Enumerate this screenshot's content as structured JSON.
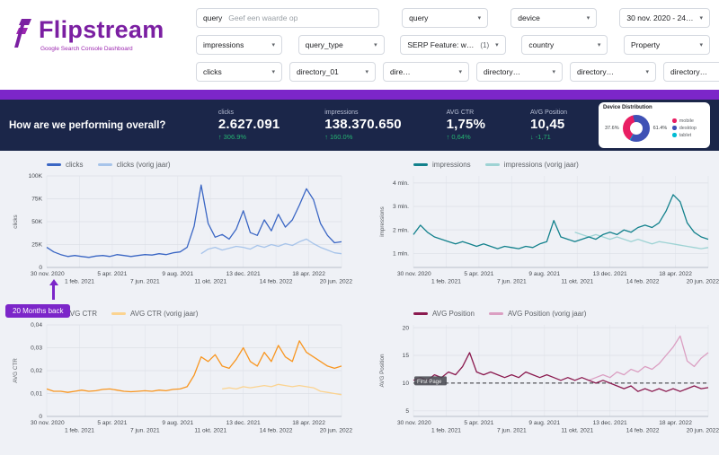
{
  "brand": {
    "name": "Flipstream",
    "tagline": "Google Search Console Dashboard",
    "color": "#7B1FA2",
    "accent_purple": "#7C26C9"
  },
  "filters": {
    "rows": [
      [
        {
          "id": "query-search",
          "kind": "search",
          "label": "query",
          "placeholder": "Geef een waarde op"
        },
        {
          "id": "query-dropdown",
          "kind": "dropdown",
          "label": "query"
        },
        {
          "id": "device",
          "kind": "dropdown",
          "label": "device"
        },
        {
          "id": "date-range",
          "kind": "dropdown",
          "label": "30 nov. 2020 - 24…"
        }
      ],
      [
        {
          "id": "impressions",
          "kind": "dropdown",
          "label": "impressions"
        },
        {
          "id": "query-type",
          "kind": "dropdown",
          "label": "query_type"
        },
        {
          "id": "serp-feature",
          "kind": "dropdown",
          "label": "SERP Feature: w…",
          "badge": "(1)"
        },
        {
          "id": "country",
          "kind": "dropdown",
          "label": "country"
        },
        {
          "id": "property",
          "kind": "dropdown",
          "label": "Property"
        }
      ],
      [
        {
          "id": "clicks",
          "kind": "dropdown",
          "label": "clicks"
        },
        {
          "id": "directory-01",
          "kind": "dropdown",
          "label": "directory_01"
        },
        {
          "id": "directory-02",
          "kind": "dropdown",
          "label": "dire…"
        },
        {
          "id": "directory-03",
          "kind": "dropdown",
          "label": "directory…"
        },
        {
          "id": "directory-04",
          "kind": "dropdown",
          "label": "directory…"
        },
        {
          "id": "directory-05",
          "kind": "dropdown",
          "label": "directory…"
        }
      ]
    ]
  },
  "overview": {
    "title": "How are we performing overall?",
    "band_color": "#1B2649",
    "delta_color": "#25B372",
    "kpis": [
      {
        "label": "clicks",
        "value": "2.627.091",
        "delta": "306.9%",
        "direction": "up"
      },
      {
        "label": "impressions",
        "value": "138.370.650",
        "delta": "160.0%",
        "direction": "up"
      },
      {
        "label": "AVG CTR",
        "value": "1,75%",
        "delta": "0,64%",
        "direction": "up"
      },
      {
        "label": "AVG Position",
        "value": "10,45",
        "delta": "-1,71",
        "direction": "down"
      }
    ],
    "device_distribution": {
      "title": "Device Distribution",
      "slices": [
        {
          "label": "mobile",
          "value": 37.6,
          "color": "#E91E63",
          "shown_label": "37.6%"
        },
        {
          "label": "desktop",
          "value": 61.4,
          "color": "#3F51B5",
          "shown_label": "61.4%"
        },
        {
          "label": "tablet",
          "value": 1.0,
          "color": "#00BCD4"
        }
      ]
    }
  },
  "annotation": {
    "text": "20 Months back",
    "color": "#7C26C9"
  },
  "chart_data": [
    {
      "id": "clicks",
      "type": "line",
      "title": "clicks",
      "ylabel": "clicks",
      "legend_position": "top-left",
      "grid": true,
      "ylim": [
        0,
        100000
      ],
      "yticks": [
        {
          "v": 0,
          "label": "0"
        },
        {
          "v": 25000,
          "label": "25K"
        },
        {
          "v": 50000,
          "label": "50K"
        },
        {
          "v": 75000,
          "label": "75K"
        },
        {
          "v": 100000,
          "label": "100K"
        }
      ],
      "x_labels": [
        "30 nov. 2020",
        "1 feb. 2021",
        "5 apr. 2021",
        "7 jun. 2021",
        "9 aug. 2021",
        "11 okt. 2021",
        "13 dec. 2021",
        "14 feb. 2022",
        "18 apr. 2022",
        "20 jun. 2022"
      ],
      "series": [
        {
          "name": "clicks",
          "color": "#3A66C4",
          "values": [
            22000,
            17000,
            14000,
            12000,
            13000,
            12000,
            11000,
            12500,
            13000,
            12000,
            14000,
            13000,
            12000,
            13000,
            14000,
            13500,
            15000,
            14000,
            16000,
            17000,
            22000,
            45000,
            90000,
            48000,
            33000,
            36000,
            31000,
            42000,
            62000,
            38000,
            35000,
            52000,
            40000,
            58000,
            44000,
            52000,
            68000,
            86000,
            74000,
            48000,
            35000,
            27000,
            28000
          ]
        },
        {
          "name": "clicks (vorig jaar)",
          "color": "#A7C4EA",
          "values": [
            null,
            null,
            null,
            null,
            null,
            null,
            null,
            null,
            null,
            null,
            null,
            null,
            null,
            null,
            null,
            null,
            null,
            null,
            null,
            null,
            null,
            null,
            15000,
            20000,
            22000,
            19000,
            21000,
            23000,
            22000,
            20000,
            24000,
            22000,
            25000,
            23000,
            26000,
            24000,
            28000,
            31000,
            26000,
            22000,
            19000,
            16000,
            15000
          ]
        }
      ]
    },
    {
      "id": "impressions",
      "type": "line",
      "title": "impressions",
      "ylabel": "impressions",
      "legend_position": "top-left",
      "grid": true,
      "unit": "mln.",
      "ylim": [
        0.4,
        4.3
      ],
      "yticks": [
        {
          "v": 1,
          "label": "1 mln."
        },
        {
          "v": 2,
          "label": "2 mln."
        },
        {
          "v": 3,
          "label": "3 mln."
        },
        {
          "v": 4,
          "label": "4 mln."
        }
      ],
      "x_labels": [
        "30 nov. 2020",
        "1 feb. 2021",
        "5 apr. 2021",
        "7 jun. 2021",
        "9 aug. 2021",
        "11 okt. 2021",
        "13 dec. 2021",
        "14 feb. 2022",
        "18 apr. 2022",
        "20 jun. 2022"
      ],
      "series": [
        {
          "name": "impressions",
          "color": "#12818C",
          "values": [
            1.8,
            2.2,
            1.9,
            1.7,
            1.6,
            1.5,
            1.4,
            1.5,
            1.4,
            1.3,
            1.4,
            1.3,
            1.2,
            1.3,
            1.25,
            1.2,
            1.3,
            1.25,
            1.4,
            1.5,
            2.4,
            1.7,
            1.6,
            1.5,
            1.6,
            1.7,
            1.6,
            1.8,
            1.9,
            1.8,
            2.0,
            1.9,
            2.1,
            2.2,
            2.1,
            2.3,
            2.8,
            3.5,
            3.2,
            2.3,
            1.9,
            1.7,
            1.6
          ]
        },
        {
          "name": "impressions (vorig jaar)",
          "color": "#9ED3D4",
          "values": [
            null,
            null,
            null,
            null,
            null,
            null,
            null,
            null,
            null,
            null,
            null,
            null,
            null,
            null,
            null,
            null,
            null,
            null,
            null,
            null,
            null,
            null,
            null,
            1.9,
            1.8,
            1.7,
            1.8,
            1.7,
            1.6,
            1.7,
            1.6,
            1.5,
            1.6,
            1.5,
            1.4,
            1.5,
            1.45,
            1.4,
            1.35,
            1.3,
            1.25,
            1.2,
            1.25
          ]
        }
      ]
    },
    {
      "id": "avg-ctr",
      "type": "line",
      "title": "AVG CTR",
      "ylabel": "AVG CTR",
      "legend_position": "top-left",
      "grid": true,
      "ylim": [
        0,
        0.04
      ],
      "yticks": [
        {
          "v": 0,
          "label": "0"
        },
        {
          "v": 0.01,
          "label": "0,01"
        },
        {
          "v": 0.02,
          "label": "0,02"
        },
        {
          "v": 0.03,
          "label": "0,03"
        },
        {
          "v": 0.04,
          "label": "0,04"
        }
      ],
      "x_labels": [
        "30 nov. 2020",
        "1 feb. 2021",
        "5 apr. 2021",
        "7 jun. 2021",
        "9 aug. 2021",
        "11 okt. 2021",
        "13 dec. 2021",
        "14 feb. 2022",
        "18 apr. 2022",
        "20 jun. 2022"
      ],
      "series": [
        {
          "name": "AVG CTR",
          "color": "#F89621",
          "values": [
            0.012,
            0.011,
            0.011,
            0.0105,
            0.011,
            0.0115,
            0.011,
            0.0112,
            0.0118,
            0.012,
            0.0115,
            0.011,
            0.0108,
            0.011,
            0.0112,
            0.011,
            0.0115,
            0.0112,
            0.0118,
            0.012,
            0.013,
            0.018,
            0.026,
            0.024,
            0.027,
            0.022,
            0.021,
            0.025,
            0.03,
            0.024,
            0.022,
            0.028,
            0.024,
            0.031,
            0.026,
            0.024,
            0.033,
            0.028,
            0.026,
            0.024,
            0.022,
            0.021,
            0.022
          ]
        },
        {
          "name": "AVG CTR (vorig jaar)",
          "color": "#FBD390",
          "values": [
            null,
            null,
            null,
            null,
            null,
            null,
            null,
            null,
            null,
            null,
            null,
            null,
            null,
            null,
            null,
            null,
            null,
            null,
            null,
            null,
            null,
            null,
            null,
            null,
            null,
            0.012,
            0.0125,
            0.012,
            0.013,
            0.0125,
            0.013,
            0.0135,
            0.013,
            0.014,
            0.0135,
            0.013,
            0.0135,
            0.013,
            0.0125,
            0.011,
            0.0105,
            0.01,
            0.0095
          ]
        }
      ]
    },
    {
      "id": "avg-position",
      "type": "line",
      "title": "AVG Position",
      "ylabel": "AVG Position",
      "legend_position": "top-left",
      "grid": true,
      "ylim": [
        4,
        20.5
      ],
      "yticks": [
        {
          "v": 5,
          "label": "5"
        },
        {
          "v": 10,
          "label": "10"
        },
        {
          "v": 15,
          "label": "15"
        },
        {
          "v": 20,
          "label": "20"
        }
      ],
      "refline": {
        "value": 10,
        "label": "First Page"
      },
      "x_labels": [
        "30 nov. 2020",
        "1 feb. 2021",
        "5 apr. 2021",
        "7 jun. 2021",
        "9 aug. 2021",
        "11 okt. 2021",
        "13 dec. 2021",
        "14 feb. 2022",
        "18 apr. 2022",
        "20 jun. 2022"
      ],
      "series": [
        {
          "name": "AVG Position",
          "color": "#8B1A4F",
          "values": [
            10.5,
            11,
            10.5,
            11.5,
            11,
            12,
            11.5,
            13,
            15.5,
            12,
            11.5,
            12,
            11.5,
            11,
            11.5,
            11,
            12,
            11.5,
            11,
            11.5,
            11,
            10.5,
            11,
            10.5,
            11,
            10.5,
            10,
            10.5,
            10,
            9.5,
            9,
            9.5,
            8.5,
            9,
            8.5,
            9,
            8.5,
            9,
            8.5,
            9,
            9.5,
            9,
            9.2
          ]
        },
        {
          "name": "AVG Position (vorig jaar)",
          "color": "#DB9FC2",
          "values": [
            null,
            null,
            null,
            null,
            null,
            null,
            null,
            null,
            null,
            null,
            null,
            null,
            null,
            null,
            null,
            null,
            null,
            null,
            null,
            null,
            null,
            null,
            null,
            null,
            null,
            10.5,
            11,
            11.5,
            11,
            12,
            11.5,
            12.5,
            12,
            13,
            12.5,
            13.5,
            15,
            16.5,
            18.5,
            14,
            13,
            14.5,
            15.5
          ]
        }
      ]
    }
  ]
}
